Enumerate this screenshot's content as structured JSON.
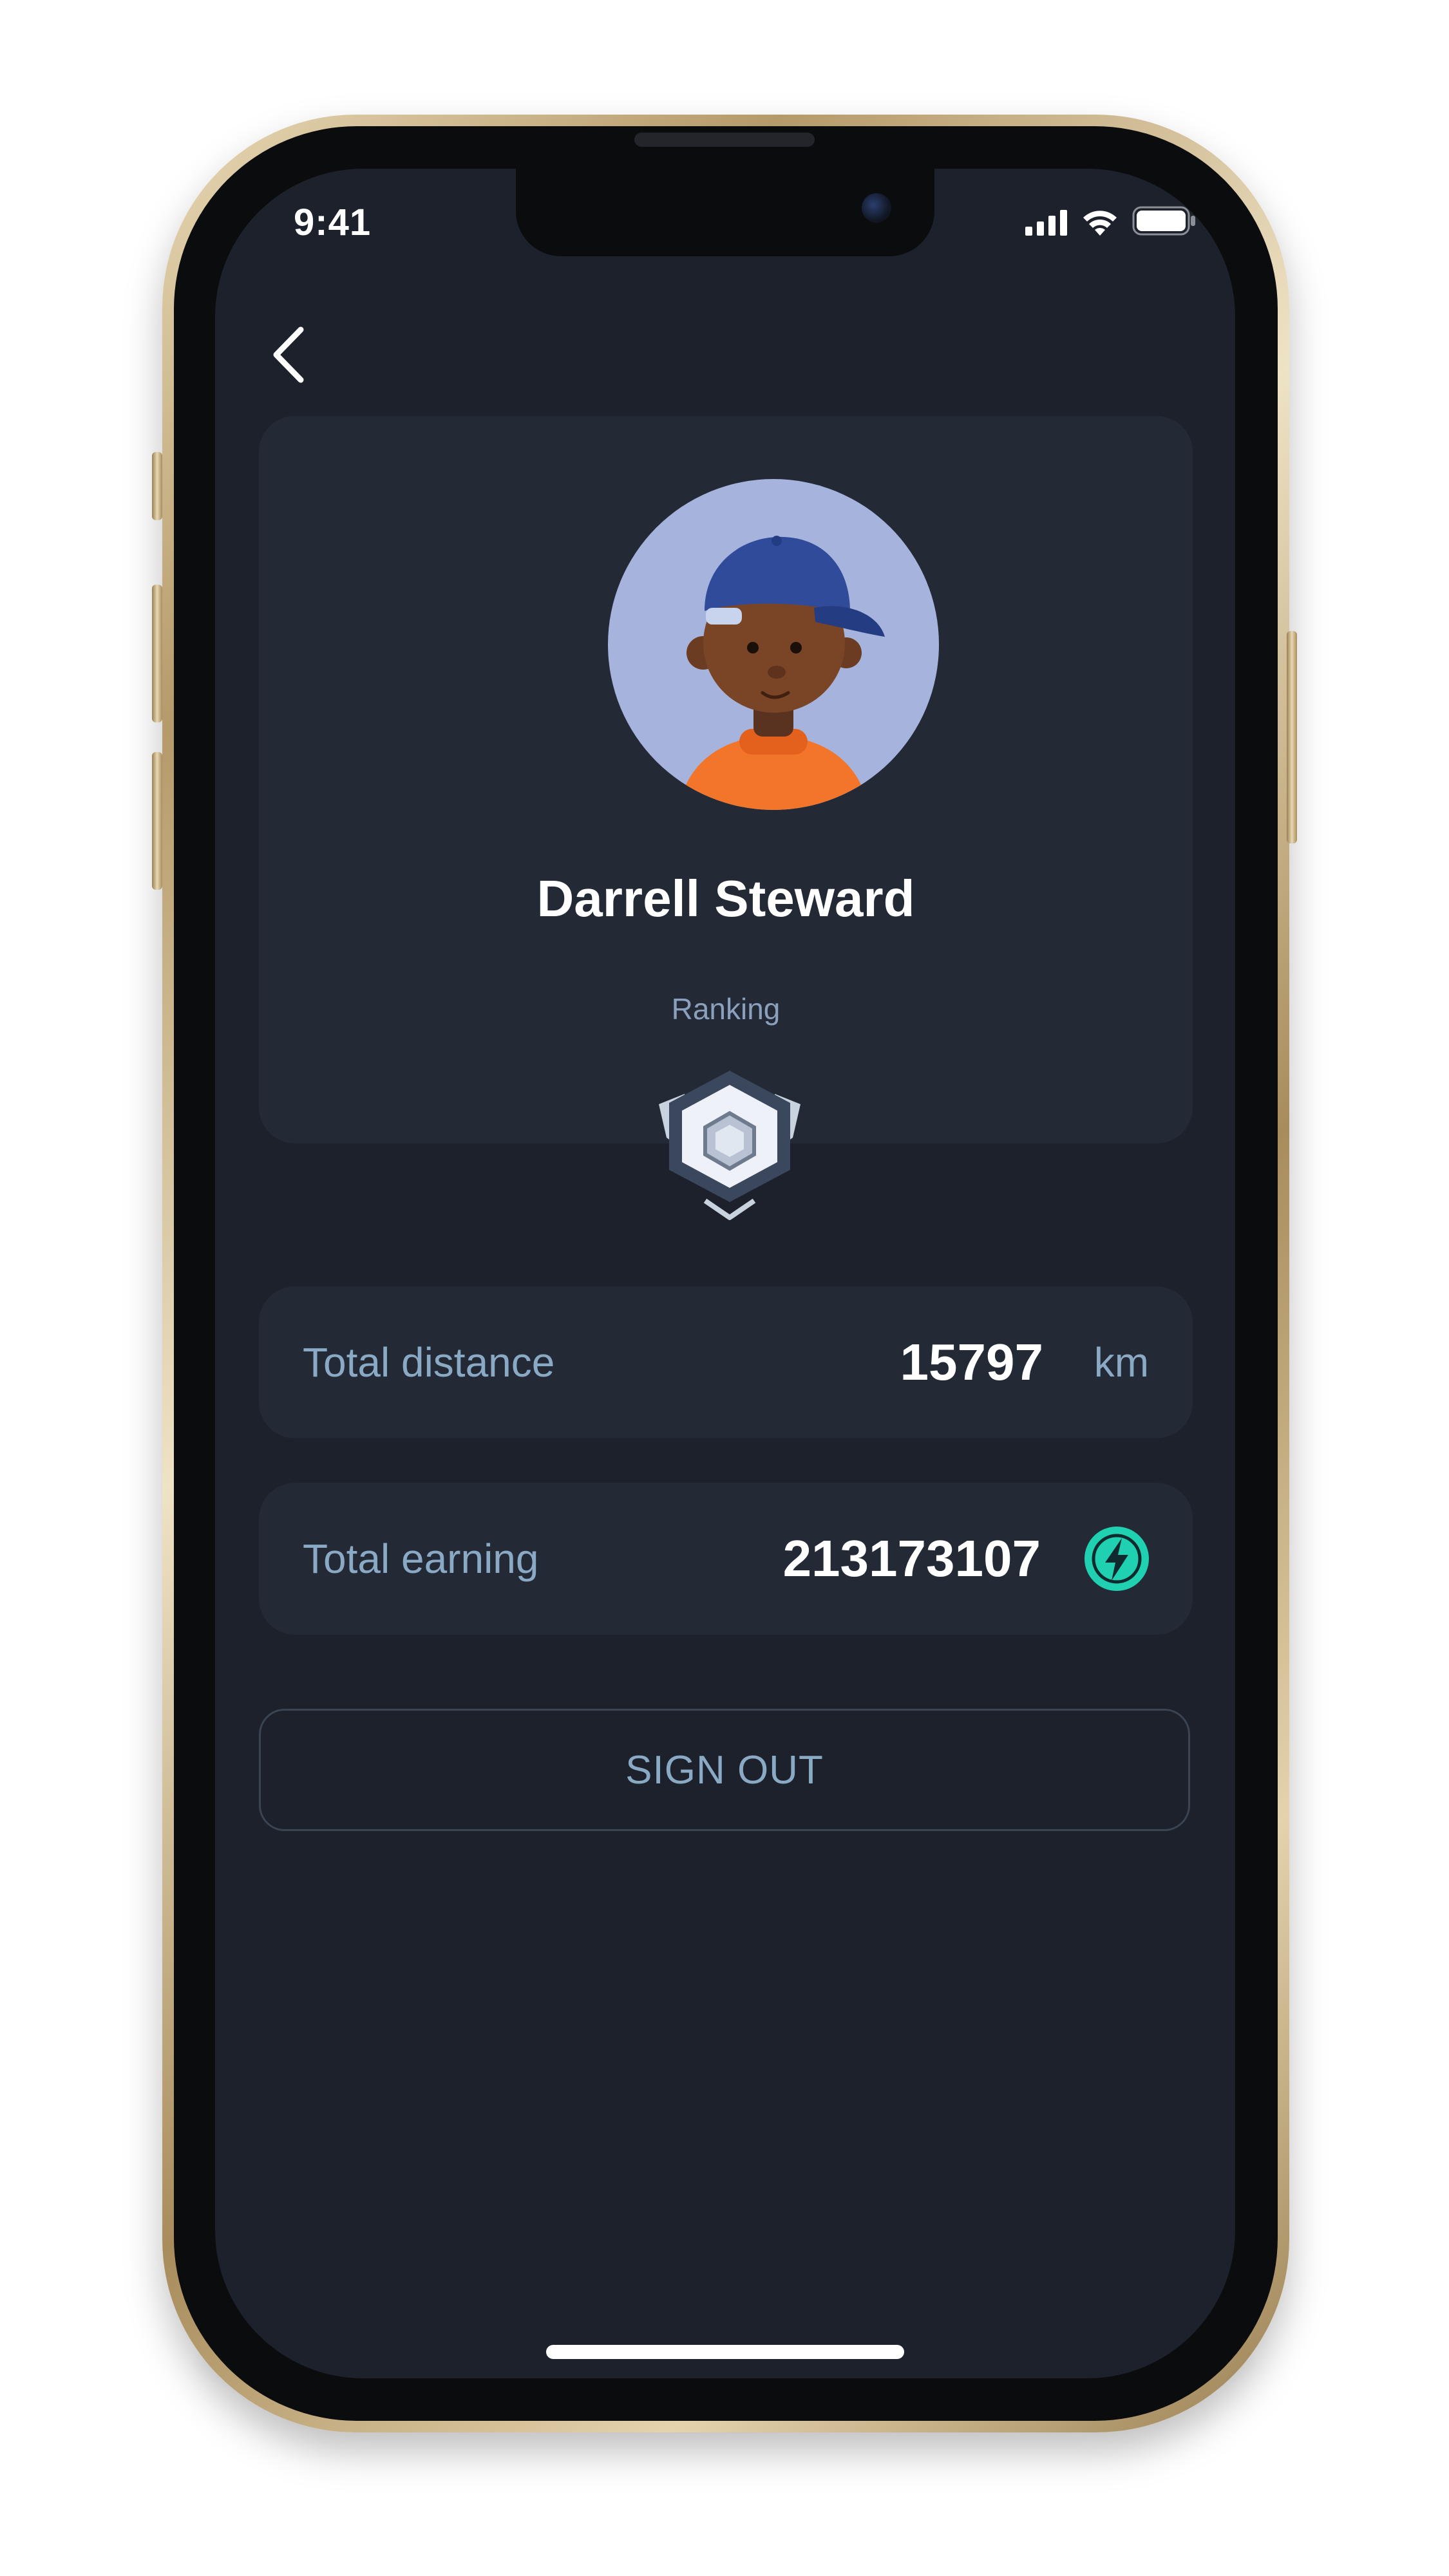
{
  "status_bar": {
    "time": "9:41",
    "signal_icon": "cellular-signal-icon",
    "wifi_icon": "wifi-icon",
    "battery_icon": "battery-icon"
  },
  "nav": {
    "back_icon": "chevron-left-icon"
  },
  "profile": {
    "avatar_icon": "avatar-3d-boy-cap",
    "name": "Darrell Steward",
    "ranking_label": "Ranking",
    "rank_badge_icon": "silver-hexagon-rank-badge"
  },
  "stats": [
    {
      "label": "Total distance",
      "value": "15797",
      "unit": "km"
    },
    {
      "label": "Total earning",
      "value": "213173107",
      "token_icon": "lightning-token-icon"
    }
  ],
  "actions": {
    "sign_out_label": "SIGN OUT"
  },
  "colors": {
    "screen_bg": "#1c212b",
    "card_bg": "#232a36",
    "label_text": "#8aa9c4",
    "accent_token": "#1fd1b0",
    "avatar_bg": "#a6b3dd"
  }
}
